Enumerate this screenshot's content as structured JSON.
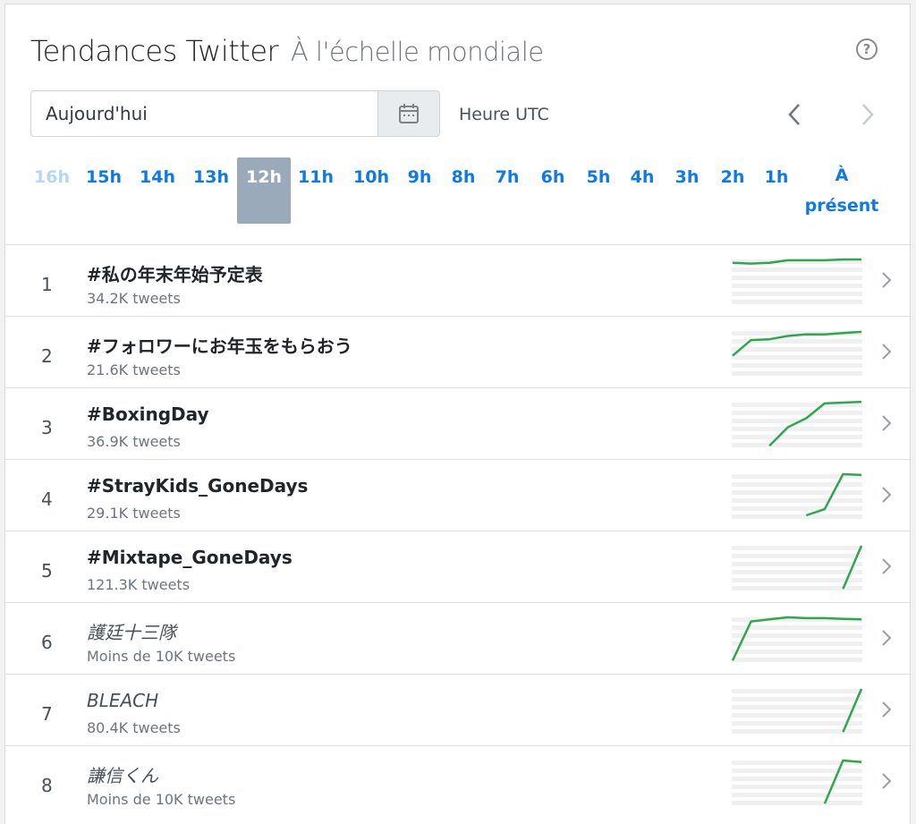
{
  "header": {
    "title": "Tendances Twitter",
    "scope": "À l'échelle mondiale",
    "help_label": "?"
  },
  "controls": {
    "date_value": "Aujourd'hui",
    "timezone": "Heure UTC"
  },
  "hours": [
    {
      "label": "16h",
      "state": "faded"
    },
    {
      "label": "15h",
      "state": ""
    },
    {
      "label": "14h",
      "state": ""
    },
    {
      "label": "13h",
      "state": ""
    },
    {
      "label": "12h",
      "state": "active"
    },
    {
      "label": "11h",
      "state": ""
    },
    {
      "label": "10h",
      "state": ""
    },
    {
      "label": "9h",
      "state": ""
    },
    {
      "label": "8h",
      "state": ""
    },
    {
      "label": "7h",
      "state": ""
    },
    {
      "label": "6h",
      "state": ""
    },
    {
      "label": "5h",
      "state": ""
    },
    {
      "label": "4h",
      "state": ""
    },
    {
      "label": "3h",
      "state": ""
    },
    {
      "label": "2h",
      "state": ""
    },
    {
      "label": "1h",
      "state": ""
    },
    {
      "label": "À présent",
      "state": "present"
    }
  ],
  "trends": [
    {
      "rank": "1",
      "name": "#私の年末年始予定表",
      "count": "34.2K tweets",
      "italic": false,
      "spark": [
        0.92,
        0.9,
        0.92,
        0.98,
        0.98,
        0.98,
        1.0,
        1.0
      ]
    },
    {
      "rank": "2",
      "name": "#フォロワーにお年玉をもらおう",
      "count": "21.6K tweets",
      "italic": false,
      "spark": [
        0.4,
        0.78,
        0.8,
        0.88,
        0.92,
        0.92,
        0.95,
        0.98
      ]
    },
    {
      "rank": "3",
      "name": "#BoxingDay",
      "count": "36.9K tweets",
      "italic": false,
      "spark": [
        null,
        null,
        -0.05,
        0.4,
        0.62,
        0.98,
        1.0,
        1.02
      ]
    },
    {
      "rank": "4",
      "name": "#StrayKids_GoneDays",
      "count": "29.1K tweets",
      "italic": false,
      "spark": [
        null,
        null,
        null,
        null,
        0.0,
        0.15,
        1.0,
        0.98
      ]
    },
    {
      "rank": "5",
      "name": "#Mixtape_GoneDays",
      "count": "121.3K tweets",
      "italic": false,
      "spark": [
        null,
        null,
        null,
        null,
        null,
        null,
        -0.05,
        1.0
      ]
    },
    {
      "rank": "6",
      "name": "護廷十三隊",
      "count": "Moins de 10K tweets",
      "italic": true,
      "spark": [
        -0.05,
        0.9,
        0.95,
        1.0,
        0.98,
        0.98,
        0.96,
        0.95
      ]
    },
    {
      "rank": "7",
      "name": "BLEACH",
      "count": "80.4K tweets",
      "italic": true,
      "spark": [
        null,
        null,
        null,
        null,
        null,
        null,
        -0.05,
        1.0
      ]
    },
    {
      "rank": "8",
      "name": "謙信くん",
      "count": "Moins de 10K tweets",
      "italic": true,
      "spark": [
        null,
        null,
        null,
        null,
        null,
        -0.05,
        1.0,
        0.96
      ]
    }
  ],
  "colors": {
    "accent": "#0d7ae8",
    "spark_line": "#2ea84f",
    "active_hour": "#9aaaba"
  }
}
